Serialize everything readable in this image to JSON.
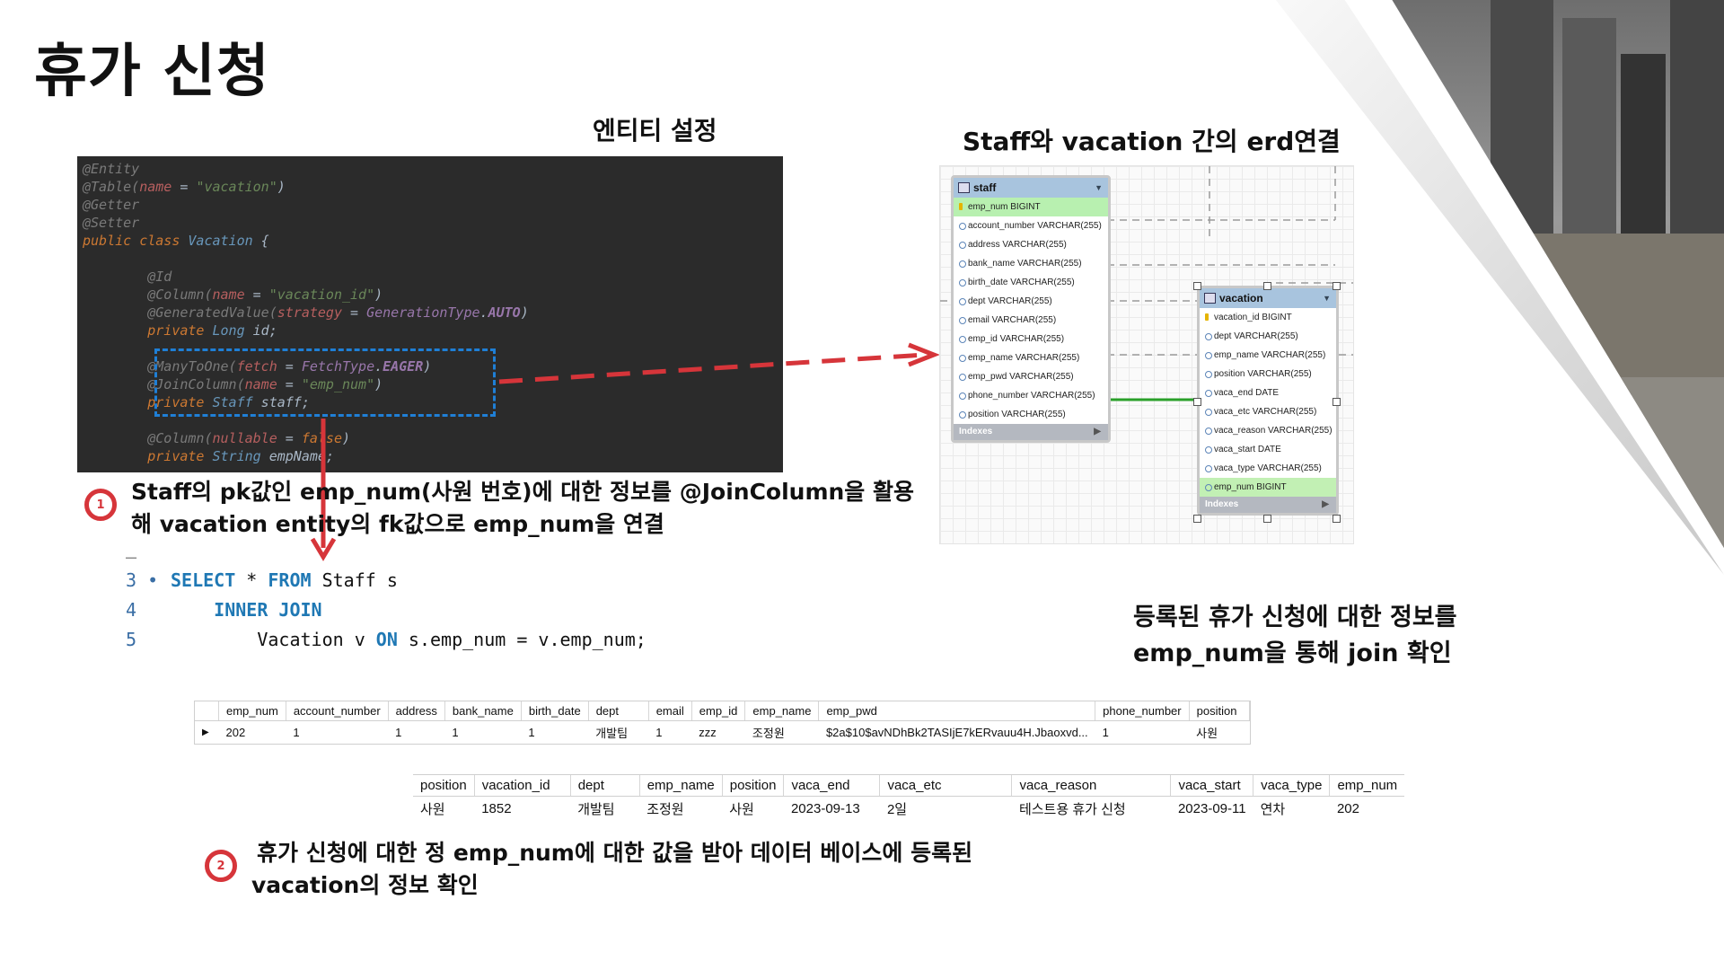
{
  "title": "휴가 신청",
  "entity_label": "엔티티 설정",
  "erd_label": "Staff와 vacation 간의 erd연결",
  "code_lines": [
    {
      "t": "@Entity"
    },
    {
      "t": "@Table(name = \"vacation\")"
    },
    {
      "t": "@Getter"
    },
    {
      "t": "@Setter"
    },
    {
      "t": "public class Vacation {"
    },
    {
      "t": ""
    },
    {
      "t": "    @Id"
    },
    {
      "t": "    @Column(name = \"vacation_id\")"
    },
    {
      "t": "    @GeneratedValue(strategy = GenerationType.AUTO)"
    },
    {
      "t": "    private Long id;"
    },
    {
      "t": ""
    },
    {
      "t": "    @ManyToOne(fetch = FetchType.EAGER)"
    },
    {
      "t": "    @JoinColumn(name = \"emp_num\")"
    },
    {
      "t": "    private Staff staff;"
    },
    {
      "t": ""
    },
    {
      "t": "    @Column(nullable = false)"
    },
    {
      "t": "    private String empName;"
    }
  ],
  "note1": {
    "badge": "1",
    "line1": "Staff의 pk값인 emp_num(사원 번호)에 대한 정보를  @JoinColumn을 활용",
    "line2": "해 vacation entity의 fk값으로 emp_num을 연결"
  },
  "sql": {
    "dash": "–",
    "lines": [
      {
        "num": "3 •",
        "kw1": "SELECT",
        "mid": " * ",
        "kw2": "FROM",
        "rest": " Staff s"
      },
      {
        "num": "4",
        "indent": "    ",
        "kw1": "INNER JOIN",
        "mid": "",
        "kw2": "",
        "rest": ""
      },
      {
        "num": "5",
        "indent": "        ",
        "kw1": "",
        "mid": "Vacation v ",
        "kw2": "ON",
        "rest": " s.emp_num = v.emp_num;"
      }
    ]
  },
  "join_note": {
    "line1": "등록된 휴가 신청에 대한 정보를",
    "line2": "emp_num을 통해 join 확인"
  },
  "erd": {
    "staff": {
      "name": "staff",
      "columns": [
        "emp_num BIGINT",
        "account_number VARCHAR(255)",
        "address VARCHAR(255)",
        "bank_name VARCHAR(255)",
        "birth_date VARCHAR(255)",
        "dept VARCHAR(255)",
        "email VARCHAR(255)",
        "emp_id VARCHAR(255)",
        "emp_name VARCHAR(255)",
        "emp_pwd VARCHAR(255)",
        "phone_number VARCHAR(255)",
        "position VARCHAR(255)"
      ],
      "indexes": "Indexes"
    },
    "vacation": {
      "name": "vacation",
      "columns": [
        "vacation_id BIGINT",
        "dept VARCHAR(255)",
        "emp_name VARCHAR(255)",
        "position VARCHAR(255)",
        "vaca_end DATE",
        "vaca_etc VARCHAR(255)",
        "vaca_reason VARCHAR(255)",
        "vaca_start DATE",
        "vaca_type VARCHAR(255)",
        "emp_num BIGINT"
      ],
      "indexes": "Indexes"
    }
  },
  "staff_result": {
    "headers": [
      "emp_num",
      "account_number",
      "address",
      "bank_name",
      "birth_date",
      "dept",
      "email",
      "emp_id",
      "emp_name",
      "emp_pwd",
      "phone_number",
      "position"
    ],
    "row": [
      "202",
      "1",
      "1",
      "1",
      "1",
      "개발팀",
      "1",
      "zzz",
      "조정원",
      "$2a$10$avNDhBk2TASIjE7kERvauu4H.Jbaoxvd...",
      "1",
      "사원"
    ]
  },
  "vacation_result": {
    "headers": [
      "position",
      "vacation_id",
      "dept",
      "emp_name",
      "position",
      "vaca_end",
      "vaca_etc",
      "vaca_reason",
      "vaca_start",
      "vaca_type",
      "emp_num"
    ],
    "row": [
      "사원",
      "1852",
      "개발팀",
      "조정원",
      "사원",
      "2023-09-13",
      "2일",
      "테스트용 휴가 신청",
      "2023-09-11",
      "연차",
      "202"
    ]
  },
  "note2": {
    "badge": "2",
    "line1": "휴가 신청에 대한 정 emp_num에 대한 값을 받아 데이터 베이스에 등록된",
    "line2": "vacation의 정보 확인"
  },
  "colors": {
    "accent_red": "#d6353a",
    "link_green": "#2aa02a",
    "dash_blue": "#1f7fd6",
    "code_bg": "#2b2b2b"
  }
}
